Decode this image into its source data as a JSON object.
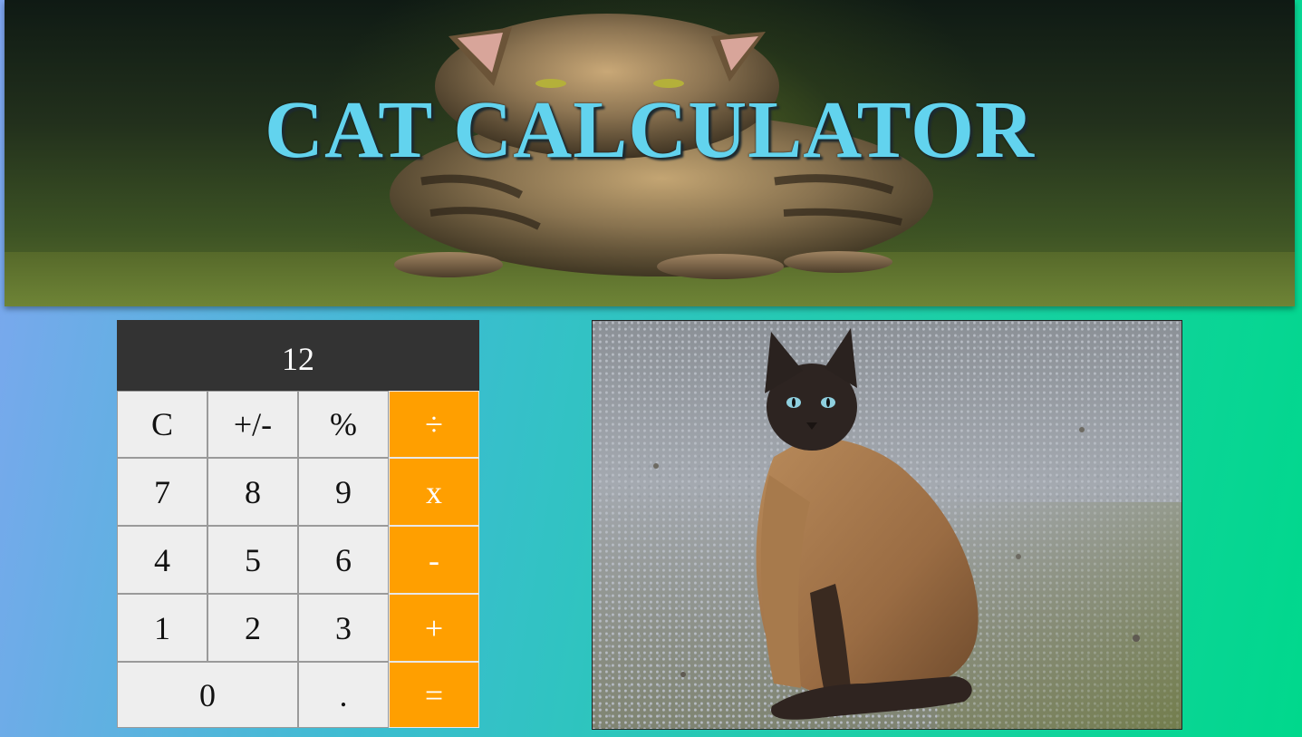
{
  "header": {
    "title": "CAT CALCULATOR"
  },
  "calculator": {
    "display": "12",
    "keys": {
      "clear": "C",
      "sign": "+/-",
      "percent": "%",
      "divide": "÷",
      "seven": "7",
      "eight": "8",
      "nine": "9",
      "multiply": "x",
      "four": "4",
      "five": "5",
      "six": "6",
      "subtract": "-",
      "one": "1",
      "two": "2",
      "three": "3",
      "add": "+",
      "zero": "0",
      "decimal": ".",
      "equals": "="
    }
  },
  "colors": {
    "title": "#62d3ee",
    "display_bg": "#333333",
    "operator_bg": "#ff9f00",
    "key_bg": "#eeeeee"
  },
  "images": {
    "banner": "tabby-cat-photo",
    "side": "siamese-cat-photo"
  }
}
